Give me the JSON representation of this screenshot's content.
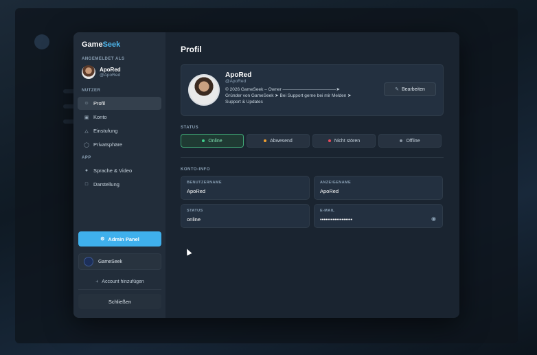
{
  "sidebar": {
    "brand_primary": "Game",
    "brand_accent": "Seek",
    "logged_in_label": "ANGEMELDET ALS",
    "user_name": "ApoRed",
    "user_handle": "@ApoRed",
    "section_user": "NUTZER",
    "section_app": "APP",
    "items_user": [
      {
        "label": "Profil",
        "icon": "user-icon",
        "active": true
      },
      {
        "label": "Konto",
        "icon": "lock-icon",
        "active": false
      },
      {
        "label": "Einstufung",
        "icon": "warning-icon",
        "active": false
      },
      {
        "label": "Privatsphäre",
        "icon": "shield-icon",
        "active": false
      }
    ],
    "items_app": [
      {
        "label": "Sprache & Video",
        "icon": "microphone-icon"
      },
      {
        "label": "Darstellung",
        "icon": "display-icon"
      }
    ],
    "admin_button": "Admin Panel",
    "account_name": "GameSeek",
    "add_account": "Account hinzufügen",
    "close_button": "Schließen"
  },
  "main": {
    "title": "Profil",
    "profile": {
      "name": "ApoRed",
      "handle": "@ApoRed",
      "line1": "© 2026 GameSeek – Owner ――――――――――――➤",
      "line2": "Gründer von GameSeek ➤ Bei Support gerne bei mir Melden ➤",
      "line3": "Support & Updates",
      "edit_button": "Bearbeiten"
    },
    "status_label": "STATUS",
    "statuses": [
      {
        "label": "Online",
        "color": "#3fcf8e",
        "active": true
      },
      {
        "label": "Abwesend",
        "color": "#f0a030",
        "active": false
      },
      {
        "label": "Nicht stören",
        "color": "#e84a5a",
        "active": false
      },
      {
        "label": "Offline",
        "color": "#8a96a3",
        "active": false
      }
    ],
    "account_info_label": "KONTO-INFO",
    "info": {
      "username_label": "BENUTZERNAME",
      "username_value": "ApoRed",
      "displayname_label": "ANZEIGENAME",
      "displayname_value": "ApoRed",
      "status_label": "STATUS",
      "status_value": "online",
      "email_label": "E-MAIL",
      "email_value": "••••••••••••••••••"
    }
  },
  "colors": {
    "accent": "#3fb0ec",
    "brand_accent": "#4fb8ee",
    "online": "#3fcf8e"
  }
}
